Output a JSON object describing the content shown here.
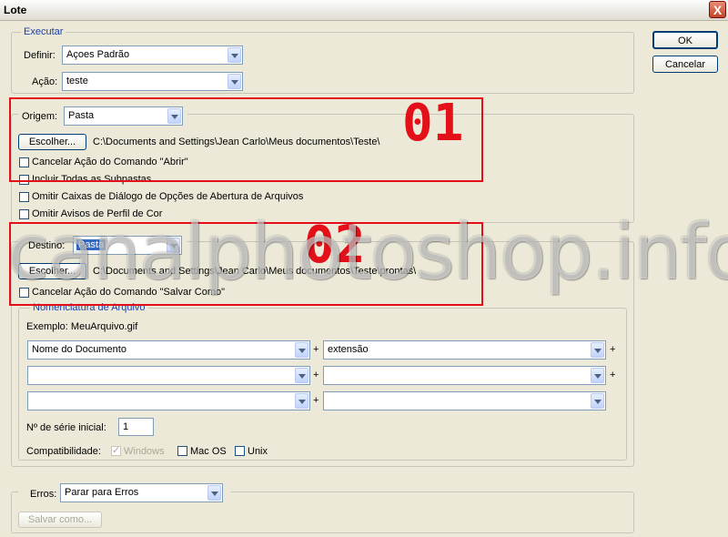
{
  "window": {
    "title": "Lote",
    "close_glyph": "X"
  },
  "buttons": {
    "ok": "OK",
    "cancel": "Cancelar"
  },
  "executar": {
    "legend": "Executar",
    "definir_label": "Definir:",
    "definir_value": "Açoes Padrão",
    "acao_label": "Ação:",
    "acao_value": "teste"
  },
  "origem": {
    "label": "Origem:",
    "value": "Pasta",
    "choose_button": "Escolher...",
    "path": "C:\\Documents and Settings\\Jean Carlo\\Meus documentos\\Teste\\",
    "options": [
      {
        "label": "Cancelar Ação do Comando \"Abrir\"",
        "checked": false
      },
      {
        "label": "Incluir Todas as Subpastas",
        "checked": false
      },
      {
        "label": "Omitir Caixas de Diálogo de Opções de Abertura de Arquivos",
        "checked": false
      },
      {
        "label": "Omitir Avisos de Perfil de Cor",
        "checked": false
      }
    ]
  },
  "destino": {
    "label": "Destino:",
    "value": "Pasta",
    "choose_button": "Escolher...",
    "path": "C:\\Documents and Settings\\Jean Carlo\\Meus documentos\\Teste\\prontas\\",
    "options": [
      {
        "label": "Cancelar Ação do Comando \"Salvar Como\"",
        "checked": false
      }
    ]
  },
  "nomenclatura": {
    "legend": "Nomenclatura de Arquivo",
    "example": "Exemplo: MeuArquivo.gif",
    "fields": [
      "Nome do Documento",
      "extensão",
      "",
      "",
      "",
      ""
    ],
    "plus": "+",
    "serial_label": "Nº de série inicial:",
    "serial_value": "1",
    "compat_label": "Compatibilidade:",
    "compat": [
      {
        "label": "Windows",
        "checked": true,
        "disabled": true
      },
      {
        "label": "Mac OS",
        "checked": false,
        "disabled": false
      },
      {
        "label": "Unix",
        "checked": false,
        "disabled": false
      }
    ]
  },
  "erros": {
    "label": "Erros:",
    "value": "Parar para Erros",
    "save_as": "Salvar como..."
  },
  "annotations": {
    "marker1": "01",
    "marker2": "02",
    "watermark": "canalphotoshop.info"
  }
}
